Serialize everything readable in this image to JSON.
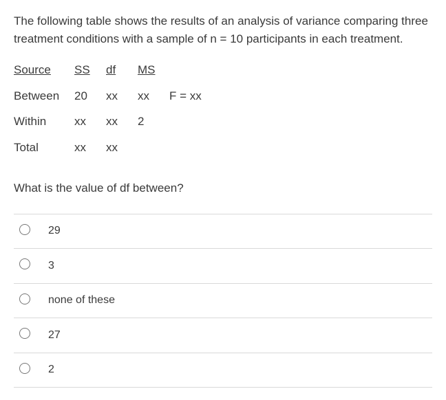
{
  "prompt": "The following table shows the results of an analysis of variance comparing three treatment conditions with a sample of n = 10 participants in each treatment.",
  "headers": {
    "source": "Source",
    "ss": "SS",
    "df": "df",
    "ms": "MS"
  },
  "rows": {
    "between": {
      "label": "Between",
      "ss": "20",
      "df": "xx",
      "ms": "xx",
      "extra": "F = xx"
    },
    "within": {
      "label": "Within",
      "ss": "xx",
      "df": "xx",
      "ms": "2",
      "extra": ""
    },
    "total": {
      "label": "Total",
      "ss": "xx",
      "df": "xx",
      "ms": "",
      "extra": ""
    }
  },
  "question": "What is the value of df between?",
  "options": [
    {
      "label": "29"
    },
    {
      "label": "3"
    },
    {
      "label": "none of these"
    },
    {
      "label": "27"
    },
    {
      "label": "2"
    }
  ]
}
